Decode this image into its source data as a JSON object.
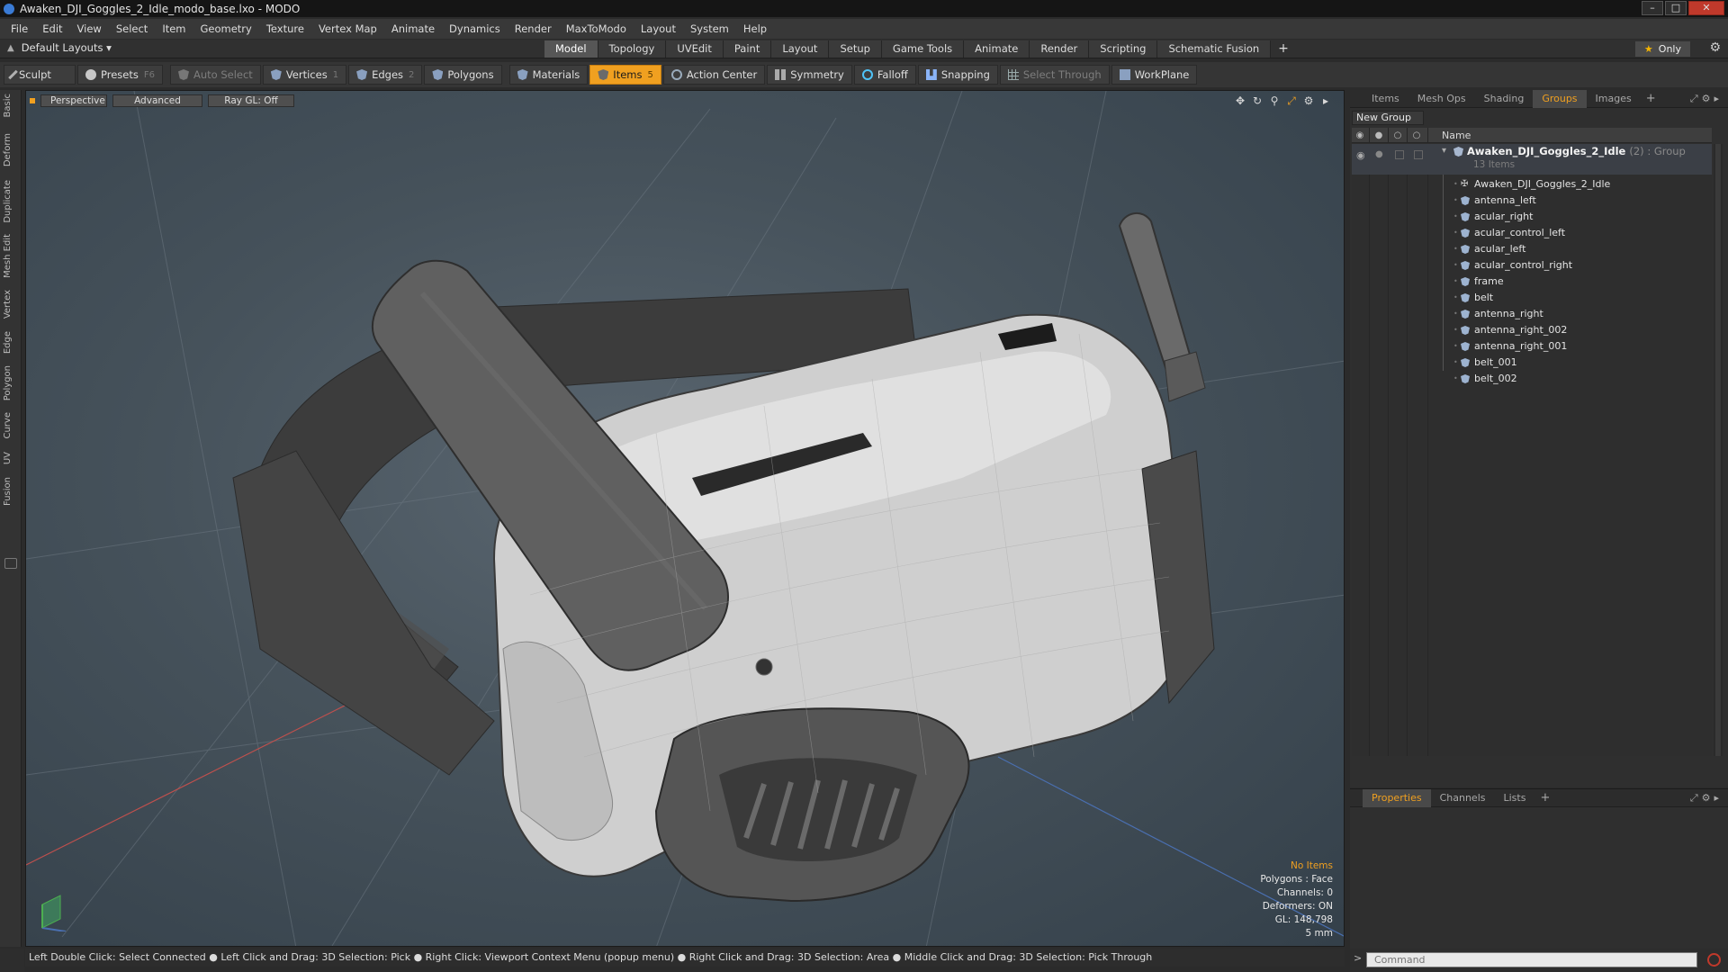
{
  "window": {
    "title": "Awaken_DJI_Goggles_2_Idle_modo_base.lxo - MODO",
    "controls": [
      "–",
      "□",
      "✕"
    ]
  },
  "menu": [
    "File",
    "Edit",
    "View",
    "Select",
    "Item",
    "Geometry",
    "Texture",
    "Vertex Map",
    "Animate",
    "Dynamics",
    "Render",
    "MaxToModo",
    "Layout",
    "System",
    "Help"
  ],
  "layouts": {
    "label": "Default Layouts ▾",
    "tabs": [
      "Model",
      "Topology",
      "UVEdit",
      "Paint",
      "Layout",
      "Setup",
      "Game Tools",
      "Animate",
      "Render",
      "Scripting",
      "Schematic Fusion"
    ],
    "active_tab": "Model",
    "add": "+",
    "only": "Only"
  },
  "toolbar": {
    "sculpt": "Sculpt",
    "presets": "Presets",
    "presets_key": "F6",
    "auto_select": "Auto Select",
    "vertices": "Vertices",
    "vertices_key": "1",
    "edges": "Edges",
    "edges_key": "2",
    "polygons": "Polygons",
    "materials": "Materials",
    "items": "Items",
    "items_key": "5",
    "action_center": "Action Center",
    "symmetry": "Symmetry",
    "falloff": "Falloff",
    "snapping": "Snapping",
    "select_through": "Select Through",
    "workplane": "WorkPlane"
  },
  "left_tabs": [
    "Basic",
    "Deform",
    "Duplicate",
    "Mesh Edit",
    "Vertex",
    "Edge",
    "Polygon",
    "Curve",
    "UV",
    "Fusion"
  ],
  "viewport": {
    "view": "Perspective",
    "mode": "Advanced",
    "raygl": "Ray GL: Off",
    "info": {
      "selection": "No Items",
      "polygons": "Polygons : Face",
      "channels": "Channels: 0",
      "deformers": "Deformers: ON",
      "gl": "GL: 148,798",
      "units": "5 mm"
    },
    "accent": "#f0a020"
  },
  "panel": {
    "tabs": [
      "Items",
      "Mesh Ops",
      "Shading",
      "Groups",
      "Images"
    ],
    "active_tab": "Groups",
    "add": "+",
    "new_group": "New Group",
    "column_name": "Name",
    "group": {
      "name": "Awaken_DJI_Goggles_2_Idle",
      "count": "(2) : Group",
      "sub": "13 Items"
    },
    "items": [
      {
        "name": "Awaken_DJI_Goggles_2_Idle",
        "icon": "locator-icon"
      },
      {
        "name": "antenna_left",
        "icon": "mesh-icon"
      },
      {
        "name": "acular_right",
        "icon": "mesh-icon"
      },
      {
        "name": "acular_control_left",
        "icon": "mesh-icon"
      },
      {
        "name": "acular_left",
        "icon": "mesh-icon"
      },
      {
        "name": "acular_control_right",
        "icon": "mesh-icon"
      },
      {
        "name": "frame",
        "icon": "mesh-icon"
      },
      {
        "name": "belt",
        "icon": "mesh-icon"
      },
      {
        "name": "antenna_right",
        "icon": "mesh-icon"
      },
      {
        "name": "antenna_right_002",
        "icon": "mesh-icon"
      },
      {
        "name": "antenna_right_001",
        "icon": "mesh-icon"
      },
      {
        "name": "belt_001",
        "icon": "mesh-icon"
      },
      {
        "name": "belt_002",
        "icon": "mesh-icon"
      }
    ]
  },
  "properties": {
    "tabs": [
      "Properties",
      "Channels",
      "Lists"
    ],
    "active_tab": "Properties",
    "add": "+"
  },
  "status": "Left Double Click: Select Connected ● Left Click and Drag: 3D Selection: Pick ● Right Click: Viewport Context Menu (popup menu) ● Right Click and Drag: 3D Selection: Area ● Middle Click and Drag: 3D Selection: Pick Through",
  "command": {
    "placeholder": "Command",
    "prompt": ">"
  }
}
